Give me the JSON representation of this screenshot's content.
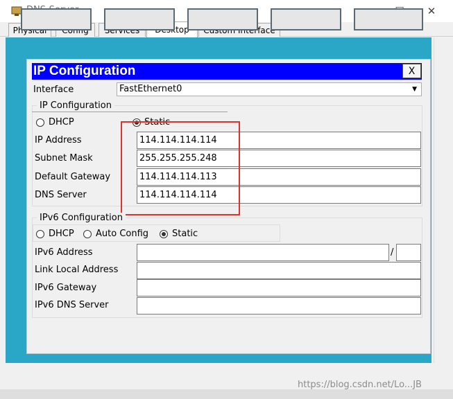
{
  "window": {
    "title": "DNS-Server",
    "min": "—",
    "max": "☐",
    "close": "✕"
  },
  "tabs": [
    "Physical",
    "Config",
    "Services",
    "Desktop",
    "Custom Interface"
  ],
  "dialog": {
    "title": "IP Configuration",
    "close": "X",
    "interface_label": "Interface",
    "interface_value": "FastEthernet0",
    "ipv4": {
      "group_title": "IP Configuration",
      "dhcp": "DHCP",
      "static": "Static",
      "mode": "Static",
      "ip_label": "IP Address",
      "ip_value": "114.114.114.114",
      "mask_label": "Subnet Mask",
      "mask_value": "255.255.255.248",
      "gw_label": "Default Gateway",
      "gw_value": "114.114.114.113",
      "dns_label": "DNS Server",
      "dns_value": "114.114.114.114"
    },
    "ipv6": {
      "group_title": "IPv6 Configuration",
      "dhcp": "DHCP",
      "auto": "Auto Config",
      "static": "Static",
      "mode": "Static",
      "addr_label": "IPv6 Address",
      "addr_value": "",
      "prefix_sep": "/",
      "prefix_value": "",
      "link_label": "Link Local Address",
      "link_value": "",
      "gw_label": "IPv6 Gateway",
      "gw_value": "",
      "dns_label": "IPv6 DNS Server",
      "dns_value": ""
    }
  },
  "watermark": "https://blog.csdn.net/Lo...JB",
  "colors": {
    "desktop_bg": "#2aa7c6",
    "dialog_title_bg": "#0000ff",
    "highlight": "#e0322a"
  }
}
